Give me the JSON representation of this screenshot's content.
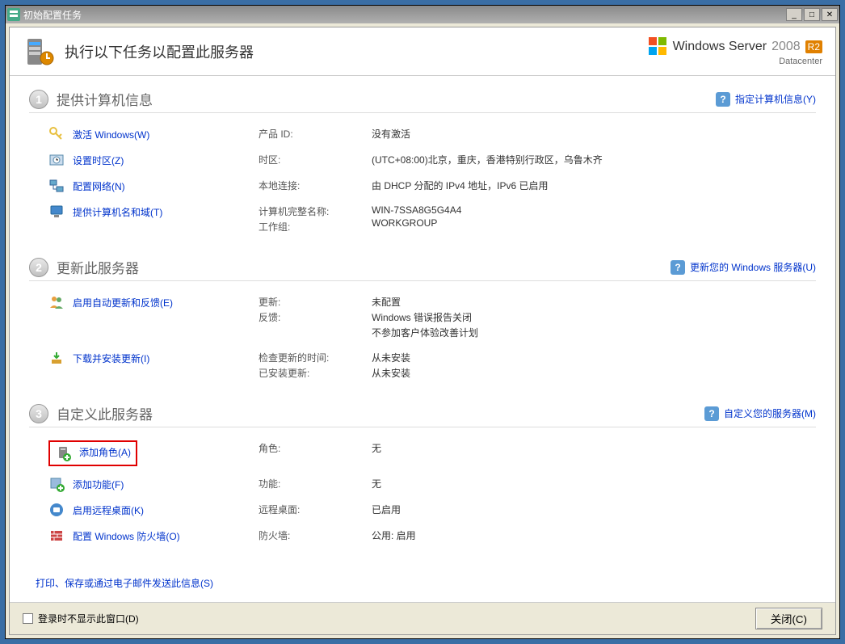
{
  "window": {
    "title": "初始配置任务"
  },
  "header": {
    "text": "执行以下任务以配置此服务器",
    "brand_main": "Windows Server",
    "brand_year": "2008",
    "brand_r2": "R2",
    "brand_sub": "Datacenter"
  },
  "sections": {
    "s1": {
      "num": "1",
      "title": "提供计算机信息",
      "help": "指定计算机信息(Y)",
      "rows": {
        "activate": {
          "action": "激活 Windows(W)",
          "label1": "产品 ID:",
          "value1": "没有激活"
        },
        "timezone": {
          "action": "设置时区(Z)",
          "label1": "时区:",
          "value1": "(UTC+08:00)北京，重庆，香港特别行政区，乌鲁木齐"
        },
        "network": {
          "action": "配置网络(N)",
          "label1": "本地连接:",
          "value1": "由 DHCP 分配的 IPv4 地址，IPv6 已启用"
        },
        "name": {
          "action": "提供计算机名和域(T)",
          "label1": "计算机完整名称:",
          "label2": "工作组:",
          "value1": "WIN-7SSA8G5G4A4",
          "value2": "WORKGROUP"
        }
      }
    },
    "s2": {
      "num": "2",
      "title": "更新此服务器",
      "help": "更新您的 Windows 服务器(U)",
      "rows": {
        "autoupdate": {
          "action": "启用自动更新和反馈(E)",
          "label1": "更新:",
          "label2": "反馈:",
          "value1": "未配置",
          "value2": "Windows 错误报告关闭",
          "value3": "不参加客户体验改善计划"
        },
        "download": {
          "action": "下载并安装更新(I)",
          "label1": "检查更新的时间:",
          "label2": "已安装更新:",
          "value1": "从未安装",
          "value2": "从未安装"
        }
      }
    },
    "s3": {
      "num": "3",
      "title": "自定义此服务器",
      "help": "自定义您的服务器(M)",
      "rows": {
        "addrole": {
          "action": "添加角色(A)",
          "label1": "角色:",
          "value1": "无"
        },
        "addfeature": {
          "action": "添加功能(F)",
          "label1": "功能:",
          "value1": "无"
        },
        "remotedesktop": {
          "action": "启用远程桌面(K)",
          "label1": "远程桌面:",
          "value1": "已启用"
        },
        "firewall": {
          "action": "配置 Windows 防火墙(O)",
          "label1": "防火墙:",
          "value1": "公用: 启用"
        }
      }
    }
  },
  "footer_link": "打印、保存或通过电子邮件发送此信息(S)",
  "bottom": {
    "checkbox_label": "登录时不显示此窗口(D)",
    "close_btn": "关闭(C)"
  }
}
